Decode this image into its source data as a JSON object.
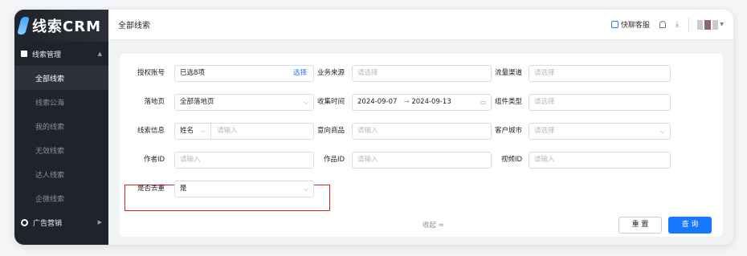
{
  "sidebar": {
    "logo": "线索CRM",
    "group1": "线索管理",
    "items": [
      "全部线索",
      "线索公海",
      "我的线索",
      "无效线索",
      "达人线索",
      "企微线索"
    ],
    "group2": "广告营销"
  },
  "header": {
    "title": "全部线索",
    "customer_service": "快聊客服"
  },
  "form": {
    "auth_account": {
      "label": "授权账号",
      "value": "已选8项",
      "action": "选择"
    },
    "biz_source": {
      "label": "业务来源",
      "placeholder": "请选择"
    },
    "traffic_channel": {
      "label": "流量渠道",
      "placeholder": "请选择"
    },
    "landing_page": {
      "label": "落地页",
      "value": "全部落地页"
    },
    "collect_time": {
      "label": "收集时间",
      "start": "2024-09-07",
      "sep": "→",
      "end": "2024-09-13"
    },
    "component_type": {
      "label": "组件类型",
      "placeholder": "请选择"
    },
    "lead_info": {
      "label": "线索信息",
      "type": "姓名",
      "placeholder": "请输入"
    },
    "intent_goods": {
      "label": "意向商品",
      "placeholder": "请输入"
    },
    "customer_city": {
      "label": "客户城市",
      "placeholder": "请选择"
    },
    "author_id": {
      "label": "作者ID",
      "placeholder": "请输入"
    },
    "work_id": {
      "label": "作品ID",
      "placeholder": "请输入"
    },
    "video_id": {
      "label": "视频ID",
      "placeholder": "请输入"
    },
    "dedupe": {
      "label": "是否去重",
      "value": "是"
    }
  },
  "actions": {
    "collapse": "收起 ≈",
    "reset": "重 置",
    "query": "查 询"
  }
}
